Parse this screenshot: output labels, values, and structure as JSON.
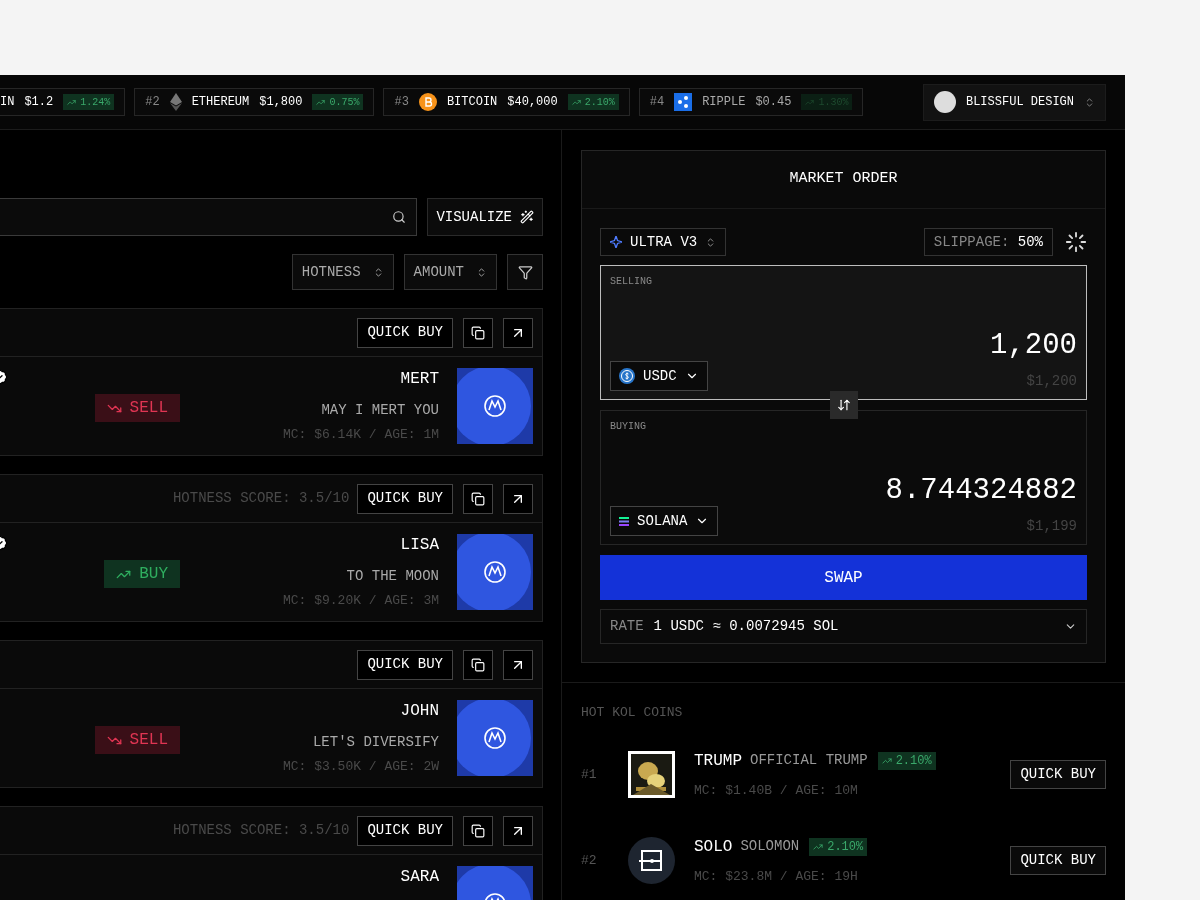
{
  "ticker": [
    {
      "name": "IN",
      "price": "$1.2",
      "change": "1.24%",
      "faded": false
    },
    {
      "rank": "#2",
      "name": "ETHEREUM",
      "price": "$1,800",
      "change": "0.75%",
      "faded": false
    },
    {
      "rank": "#3",
      "name": "BITCOIN",
      "price": "$40,000",
      "change": "2.10%",
      "faded": false
    },
    {
      "rank": "#4",
      "name": "RIPPLE",
      "price": "$0.45",
      "change": "1.30%",
      "faded": true
    }
  ],
  "account": {
    "name": "BLISSFUL DESIGN"
  },
  "visualize_button": "VISUALIZE",
  "sort_buttons": [
    "HOTNESS",
    "AMOUNT"
  ],
  "posts": [
    {
      "name": "MERT",
      "tagline": "MAY I MERT YOU",
      "meta": "MC: $6.14K / AGE: 1M",
      "signal": {
        "kind": "sell",
        "label": "SELL"
      },
      "verified": true,
      "quick_buy": "QUICK BUY"
    },
    {
      "hotness": "HOTNESS SCORE: 3.5/10",
      "name": "LISA",
      "tagline": "TO THE MOON",
      "meta": "MC: $9.20K / AGE: 3M",
      "signal": {
        "kind": "buy",
        "label": "BUY"
      },
      "verified": true,
      "quick_buy": "QUICK BUY"
    },
    {
      "name": "JOHN",
      "tagline": "LET'S DIVERSIFY",
      "meta": "MC: $3.50K / AGE: 2W",
      "signal": {
        "kind": "sell",
        "label": "SELL"
      },
      "verified": false,
      "quick_buy": "QUICK BUY"
    },
    {
      "hotness": "HOTNESS SCORE: 3.5/10",
      "name": "SARA",
      "verified": false,
      "quick_buy": "QUICK BUY"
    }
  ],
  "order": {
    "title": "MARKET ORDER",
    "route": "ULTRA V3",
    "slippage_label": "SLIPPAGE:",
    "slippage_value": "50%",
    "selling": {
      "label": "SELLING",
      "amount": "1,200",
      "token": "USDC",
      "usd": "$1,200",
      "active": true
    },
    "buying": {
      "label": "BUYING",
      "amount": "8.744324882",
      "token": "SOLANA",
      "usd": "$1,199",
      "active": false
    },
    "swap": "SWAP",
    "rate_label": "RATE",
    "rate_value": "1 USDC ≈ 0.0072945 SOL"
  },
  "kol": {
    "title": "HOT KOL COINS",
    "items": [
      {
        "rank": "#1",
        "symbol": "TRUMP",
        "name": "OFFICIAL TRUMP",
        "change": "2.10%",
        "meta": "MC: $1.40B / AGE: 10M",
        "button": "QUICK BUY"
      },
      {
        "rank": "#2",
        "symbol": "SOLO",
        "name": "SOLOMON",
        "change": "2.10%",
        "meta": "MC: $23.8M / AGE: 19H",
        "button": "QUICK BUY"
      }
    ]
  }
}
